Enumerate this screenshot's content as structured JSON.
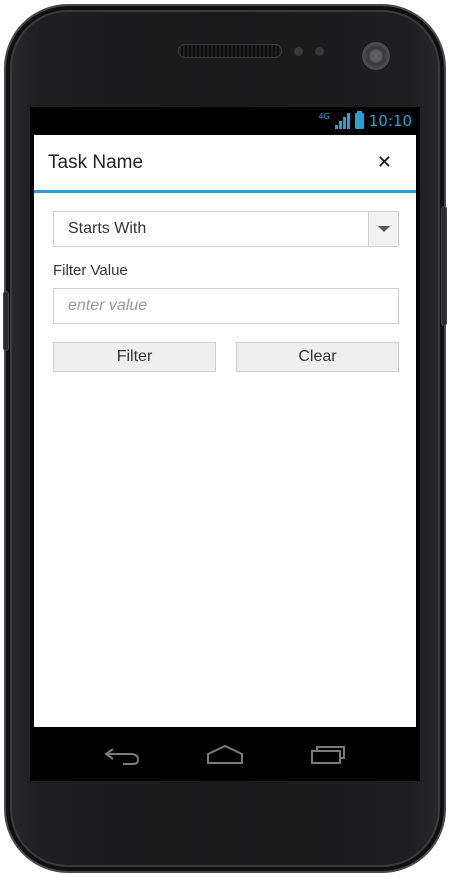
{
  "status_bar": {
    "network": "4G",
    "time": "10:10",
    "accent_color": "#2aa0d8"
  },
  "dialog": {
    "title": "Task Name",
    "close_icon": "close-icon",
    "operator_select": {
      "value": "Starts With"
    },
    "filter_value_label": "Filter Value",
    "filter_value_input": {
      "value": "",
      "placeholder": "enter value"
    },
    "buttons": {
      "filter": "Filter",
      "clear": "Clear"
    },
    "accent_color": "#2b9bd2"
  },
  "nav_bar": {
    "icons": [
      "back-icon",
      "home-icon",
      "recent-apps-icon"
    ]
  }
}
